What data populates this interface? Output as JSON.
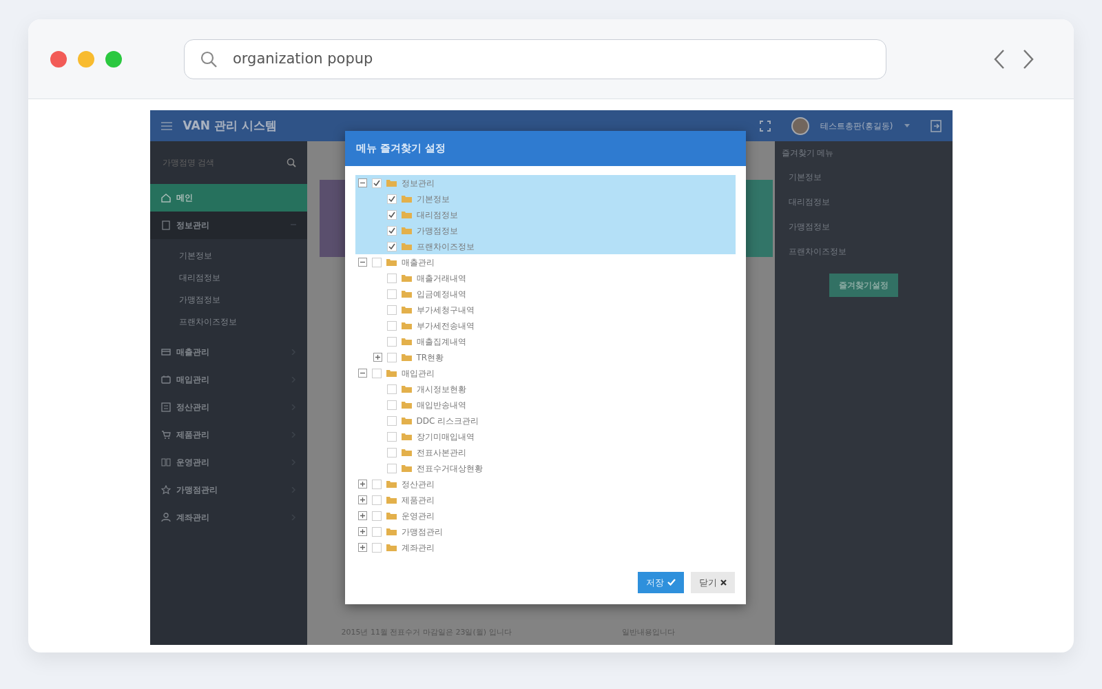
{
  "browser": {
    "search": {
      "value": "organization popup"
    }
  },
  "app": {
    "title": "VAN 관리 시스템",
    "user": "테스트총판(홍길동)",
    "sidebar": {
      "search": {
        "placeholder": "가맹점명 검색"
      },
      "items": [
        {
          "label": "메인",
          "kind": "home",
          "selected": true,
          "expanded": false
        },
        {
          "label": "정보관리",
          "kind": "doc",
          "selected": false,
          "expanded": true,
          "children": [
            {
              "label": "기본정보"
            },
            {
              "label": "대리점정보"
            },
            {
              "label": "가맹점정보"
            },
            {
              "label": "프랜차이즈정보"
            }
          ]
        },
        {
          "label": "매출관리",
          "kind": "card",
          "selected": false,
          "expanded": false
        },
        {
          "label": "매입관리",
          "kind": "box",
          "selected": false,
          "expanded": false
        },
        {
          "label": "정산관리",
          "kind": "calc",
          "selected": false,
          "expanded": false
        },
        {
          "label": "제품관리",
          "kind": "cart",
          "selected": false,
          "expanded": false
        },
        {
          "label": "운영관리",
          "kind": "grid",
          "selected": false,
          "expanded": false
        },
        {
          "label": "가맹점관리",
          "kind": "star",
          "selected": false,
          "expanded": false
        },
        {
          "label": "계좌관리",
          "kind": "user",
          "selected": false,
          "expanded": false
        }
      ]
    },
    "notices": [
      {
        "text": "2015년 11월 전표수거 마감일은 23일(월) 입니다",
        "note": "일반내용입니다"
      }
    ],
    "favorites": {
      "title": "즐겨찾기 메뉴",
      "items": [
        "기본정보",
        "대리점정보",
        "가맹점정보",
        "프랜차이즈정보"
      ],
      "button": "즐겨찾기설정"
    }
  },
  "dialog": {
    "title": "메뉴 즐겨찾기 설정",
    "tree": [
      {
        "label": "정보관리",
        "checked": true,
        "selected": true,
        "expanded": true,
        "children": [
          {
            "label": "기본정보",
            "checked": true,
            "selected": true
          },
          {
            "label": "대리점정보",
            "checked": true,
            "selected": true
          },
          {
            "label": "가맹점정보",
            "checked": true,
            "selected": true
          },
          {
            "label": "프랜차이즈정보",
            "checked": true,
            "selected": true
          }
        ]
      },
      {
        "label": "매출관리",
        "checked": false,
        "selected": false,
        "expanded": true,
        "children": [
          {
            "label": "매출거래내역",
            "checked": false,
            "selected": false
          },
          {
            "label": "입금예정내역",
            "checked": false,
            "selected": false
          },
          {
            "label": "부가세청구내역",
            "checked": false,
            "selected": false
          },
          {
            "label": "부가세전송내역",
            "checked": false,
            "selected": false
          },
          {
            "label": "매출집계내역",
            "checked": false,
            "selected": false
          },
          {
            "label": "TR현황",
            "checked": false,
            "selected": false,
            "expanded": false
          }
        ]
      },
      {
        "label": "매입관리",
        "checked": false,
        "selected": false,
        "expanded": true,
        "children": [
          {
            "label": "개시정보현황",
            "checked": false,
            "selected": false
          },
          {
            "label": "매입반송내역",
            "checked": false,
            "selected": false
          },
          {
            "label": "DDC 리스크관리",
            "checked": false,
            "selected": false
          },
          {
            "label": "장기미매입내역",
            "checked": false,
            "selected": false
          },
          {
            "label": "전표사본관리",
            "checked": false,
            "selected": false
          },
          {
            "label": "전표수거대상현황",
            "checked": false,
            "selected": false
          }
        ]
      },
      {
        "label": "정산관리",
        "checked": false,
        "selected": false,
        "expanded": false
      },
      {
        "label": "제품관리",
        "checked": false,
        "selected": false,
        "expanded": false
      },
      {
        "label": "운영관리",
        "checked": false,
        "selected": false,
        "expanded": false
      },
      {
        "label": "가맹점관리",
        "checked": false,
        "selected": false,
        "expanded": false
      },
      {
        "label": "계좌관리",
        "checked": false,
        "selected": false,
        "expanded": false
      }
    ],
    "buttons": [
      {
        "label": "저장",
        "kind": "primary"
      },
      {
        "label": "닫기",
        "kind": "secondary"
      }
    ]
  }
}
